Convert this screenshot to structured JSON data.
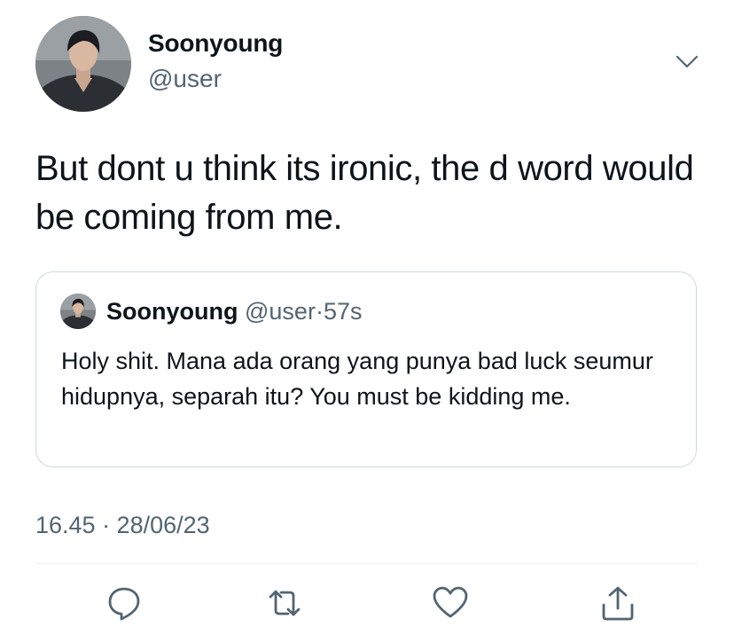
{
  "author": {
    "name": "Soonyoung",
    "handle": "@user",
    "avatar_icon": "profile-photo"
  },
  "tweet": {
    "text": "But dont u think its ironic, the d word would be coming from me."
  },
  "quoted_tweet": {
    "name": "Soonyoung",
    "handle": "@user",
    "separator": "·",
    "time": "57s",
    "text": "Holy shit. Mana ada orang yang punya bad luck seumur hidupnya, separah itu? You must be kidding me."
  },
  "timestamp": "16.45 · 28/06/23",
  "actions": [
    {
      "icon": "reply-icon"
    },
    {
      "icon": "retweet-icon"
    },
    {
      "icon": "like-icon"
    },
    {
      "icon": "share-icon"
    }
  ],
  "colors": {
    "text": "#0f1419",
    "secondary": "#536471",
    "border": "#cfd9de",
    "divider": "#eff3f4"
  }
}
